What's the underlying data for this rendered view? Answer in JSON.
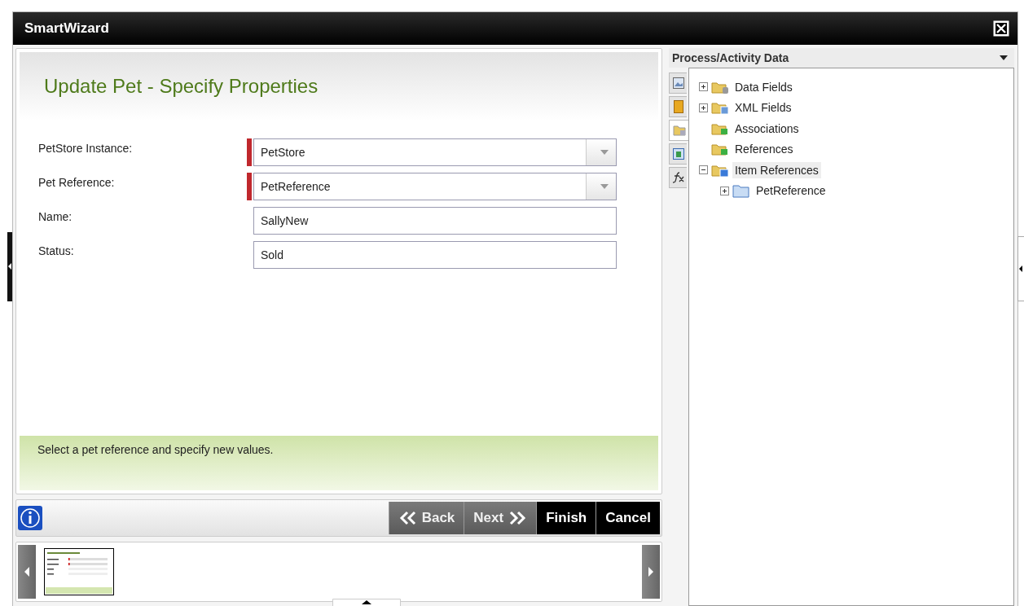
{
  "window": {
    "title": "SmartWizard"
  },
  "wizard": {
    "heading": "Update Pet - Specify Properties",
    "fields": [
      {
        "label": "PetStore Instance:",
        "kind": "dropdown",
        "value": "PetStore",
        "required": true
      },
      {
        "label": "Pet Reference:",
        "kind": "dropdown",
        "value": "PetReference",
        "required": true
      },
      {
        "label": "Name:",
        "kind": "text",
        "value": "SallyNew",
        "required": false
      },
      {
        "label": "Status:",
        "kind": "text",
        "value": "Sold",
        "required": false
      }
    ],
    "help": "Select a pet reference and specify new values.",
    "buttons": [
      {
        "label": "Back",
        "kind": "back"
      },
      {
        "label": "Next",
        "kind": "next"
      },
      {
        "label": "Finish",
        "kind": "action"
      },
      {
        "label": "Cancel",
        "kind": "action"
      }
    ]
  },
  "panel": {
    "title": "Process/Activity Data",
    "side_tabs": [
      {
        "kind": "picture",
        "selected": false
      },
      {
        "kind": "book",
        "selected": false
      },
      {
        "kind": "folder",
        "selected": true
      },
      {
        "kind": "sheet",
        "selected": false
      },
      {
        "kind": "fx",
        "selected": false
      }
    ],
    "tree": [
      {
        "label": "Data Fields",
        "kind": "data",
        "expanded": false,
        "selected": false
      },
      {
        "label": "XML Fields",
        "kind": "xml",
        "expanded": false,
        "selected": false
      },
      {
        "label": "Associations",
        "kind": "green",
        "selected": false
      },
      {
        "label": "References",
        "kind": "green",
        "selected": false
      },
      {
        "label": "Item References",
        "kind": "item",
        "expanded": true,
        "selected": true,
        "children": [
          {
            "label": "PetReference",
            "kind": "blue",
            "expanded": false,
            "selected": false
          }
        ]
      }
    ]
  }
}
